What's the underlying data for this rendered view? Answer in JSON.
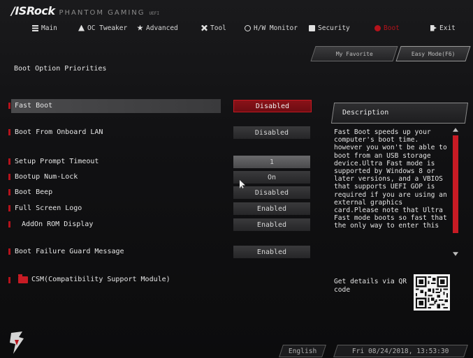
{
  "brand": {
    "logo": "/ISRock",
    "product": "PHANTOM GAMING",
    "suffix": "UEFI"
  },
  "nav": {
    "main": "Main",
    "oc_tweaker": "OC Tweaker",
    "advanced": "Advanced",
    "tool": "Tool",
    "hw_monitor": "H/W Monitor",
    "security": "Security",
    "boot": "Boot",
    "exit": "Exit"
  },
  "tabs": {
    "my_favorite": "My Favorite",
    "easy_mode": "Easy Mode(F6)"
  },
  "page_title": "Boot Option Priorities",
  "options": [
    {
      "label": "Fast Boot",
      "value": "Disabled"
    },
    {
      "label": "Boot From Onboard LAN",
      "value": "Disabled"
    },
    {
      "label": "Setup Prompt Timeout",
      "value": "1"
    },
    {
      "label": "Bootup Num-Lock",
      "value": "On"
    },
    {
      "label": "Boot Beep",
      "value": "Disabled"
    },
    {
      "label": "Full Screen Logo",
      "value": "Enabled"
    },
    {
      "label": "AddOn ROM Display",
      "value": "Enabled"
    },
    {
      "label": "Boot Failure Guard Message",
      "value": "Enabled"
    }
  ],
  "csm": {
    "label": "CSM(Compatibility Support Module)"
  },
  "description": {
    "title": "Description",
    "body": "Fast Boot speeds up your computer's boot time. however you won't be able to boot from an USB storage device.Ultra Fast mode is supported by Windows 8 or later versions, and a VBIOS that supports UEFI GOP is required if you are using an external graphics card.Please note that Ultra Fast mode boots so fast that the only way to enter this"
  },
  "qr": {
    "text": "Get details via QR code"
  },
  "footer": {
    "language": "English",
    "datetime": "Fri 08/24/2018, 13:53:30"
  },
  "colors": {
    "accent": "#b5121b",
    "background": "#111113",
    "text": "#e6e6e6"
  }
}
